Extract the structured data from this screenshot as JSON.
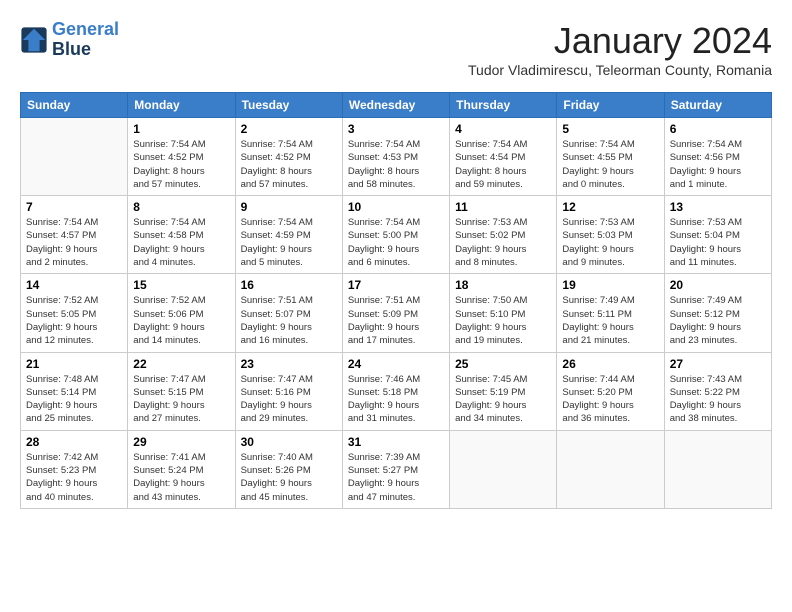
{
  "header": {
    "logo_line1": "General",
    "logo_line2": "Blue",
    "month_title": "January 2024",
    "subtitle": "Tudor Vladimirescu, Teleorman County, Romania"
  },
  "days_of_week": [
    "Sunday",
    "Monday",
    "Tuesday",
    "Wednesday",
    "Thursday",
    "Friday",
    "Saturday"
  ],
  "weeks": [
    [
      {
        "day": "",
        "info": ""
      },
      {
        "day": "1",
        "info": "Sunrise: 7:54 AM\nSunset: 4:52 PM\nDaylight: 8 hours\nand 57 minutes."
      },
      {
        "day": "2",
        "info": "Sunrise: 7:54 AM\nSunset: 4:52 PM\nDaylight: 8 hours\nand 57 minutes."
      },
      {
        "day": "3",
        "info": "Sunrise: 7:54 AM\nSunset: 4:53 PM\nDaylight: 8 hours\nand 58 minutes."
      },
      {
        "day": "4",
        "info": "Sunrise: 7:54 AM\nSunset: 4:54 PM\nDaylight: 8 hours\nand 59 minutes."
      },
      {
        "day": "5",
        "info": "Sunrise: 7:54 AM\nSunset: 4:55 PM\nDaylight: 9 hours\nand 0 minutes."
      },
      {
        "day": "6",
        "info": "Sunrise: 7:54 AM\nSunset: 4:56 PM\nDaylight: 9 hours\nand 1 minute."
      }
    ],
    [
      {
        "day": "7",
        "info": "Sunrise: 7:54 AM\nSunset: 4:57 PM\nDaylight: 9 hours\nand 2 minutes."
      },
      {
        "day": "8",
        "info": "Sunrise: 7:54 AM\nSunset: 4:58 PM\nDaylight: 9 hours\nand 4 minutes."
      },
      {
        "day": "9",
        "info": "Sunrise: 7:54 AM\nSunset: 4:59 PM\nDaylight: 9 hours\nand 5 minutes."
      },
      {
        "day": "10",
        "info": "Sunrise: 7:54 AM\nSunset: 5:00 PM\nDaylight: 9 hours\nand 6 minutes."
      },
      {
        "day": "11",
        "info": "Sunrise: 7:53 AM\nSunset: 5:02 PM\nDaylight: 9 hours\nand 8 minutes."
      },
      {
        "day": "12",
        "info": "Sunrise: 7:53 AM\nSunset: 5:03 PM\nDaylight: 9 hours\nand 9 minutes."
      },
      {
        "day": "13",
        "info": "Sunrise: 7:53 AM\nSunset: 5:04 PM\nDaylight: 9 hours\nand 11 minutes."
      }
    ],
    [
      {
        "day": "14",
        "info": "Sunrise: 7:52 AM\nSunset: 5:05 PM\nDaylight: 9 hours\nand 12 minutes."
      },
      {
        "day": "15",
        "info": "Sunrise: 7:52 AM\nSunset: 5:06 PM\nDaylight: 9 hours\nand 14 minutes."
      },
      {
        "day": "16",
        "info": "Sunrise: 7:51 AM\nSunset: 5:07 PM\nDaylight: 9 hours\nand 16 minutes."
      },
      {
        "day": "17",
        "info": "Sunrise: 7:51 AM\nSunset: 5:09 PM\nDaylight: 9 hours\nand 17 minutes."
      },
      {
        "day": "18",
        "info": "Sunrise: 7:50 AM\nSunset: 5:10 PM\nDaylight: 9 hours\nand 19 minutes."
      },
      {
        "day": "19",
        "info": "Sunrise: 7:49 AM\nSunset: 5:11 PM\nDaylight: 9 hours\nand 21 minutes."
      },
      {
        "day": "20",
        "info": "Sunrise: 7:49 AM\nSunset: 5:12 PM\nDaylight: 9 hours\nand 23 minutes."
      }
    ],
    [
      {
        "day": "21",
        "info": "Sunrise: 7:48 AM\nSunset: 5:14 PM\nDaylight: 9 hours\nand 25 minutes."
      },
      {
        "day": "22",
        "info": "Sunrise: 7:47 AM\nSunset: 5:15 PM\nDaylight: 9 hours\nand 27 minutes."
      },
      {
        "day": "23",
        "info": "Sunrise: 7:47 AM\nSunset: 5:16 PM\nDaylight: 9 hours\nand 29 minutes."
      },
      {
        "day": "24",
        "info": "Sunrise: 7:46 AM\nSunset: 5:18 PM\nDaylight: 9 hours\nand 31 minutes."
      },
      {
        "day": "25",
        "info": "Sunrise: 7:45 AM\nSunset: 5:19 PM\nDaylight: 9 hours\nand 34 minutes."
      },
      {
        "day": "26",
        "info": "Sunrise: 7:44 AM\nSunset: 5:20 PM\nDaylight: 9 hours\nand 36 minutes."
      },
      {
        "day": "27",
        "info": "Sunrise: 7:43 AM\nSunset: 5:22 PM\nDaylight: 9 hours\nand 38 minutes."
      }
    ],
    [
      {
        "day": "28",
        "info": "Sunrise: 7:42 AM\nSunset: 5:23 PM\nDaylight: 9 hours\nand 40 minutes."
      },
      {
        "day": "29",
        "info": "Sunrise: 7:41 AM\nSunset: 5:24 PM\nDaylight: 9 hours\nand 43 minutes."
      },
      {
        "day": "30",
        "info": "Sunrise: 7:40 AM\nSunset: 5:26 PM\nDaylight: 9 hours\nand 45 minutes."
      },
      {
        "day": "31",
        "info": "Sunrise: 7:39 AM\nSunset: 5:27 PM\nDaylight: 9 hours\nand 47 minutes."
      },
      {
        "day": "",
        "info": ""
      },
      {
        "day": "",
        "info": ""
      },
      {
        "day": "",
        "info": ""
      }
    ]
  ]
}
